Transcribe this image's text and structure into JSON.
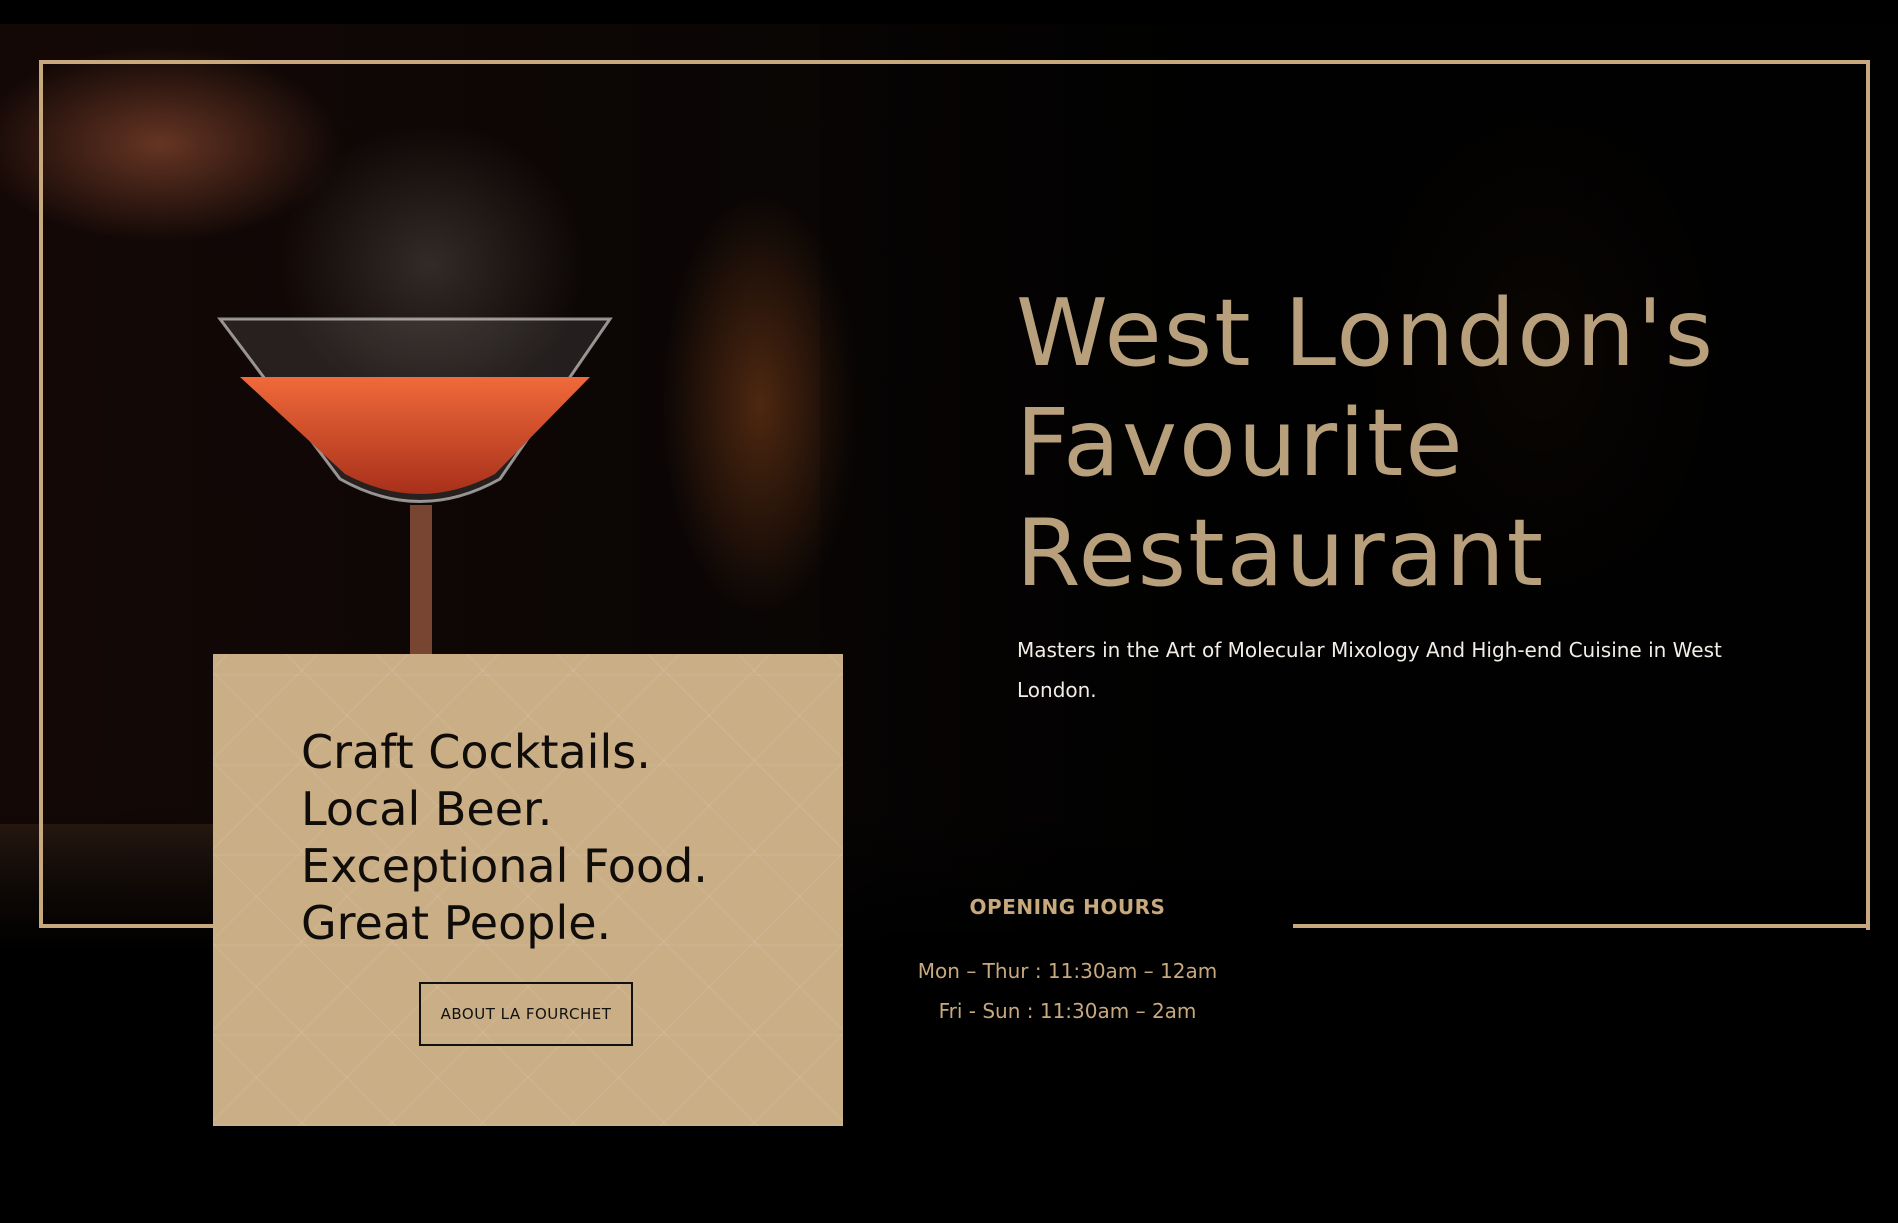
{
  "hero": {
    "headline_lines": [
      "West London's",
      "Favourite",
      "Restaurant"
    ],
    "tagline": "Masters in the Art of Molecular Mixology And High-end Cuisine in West London."
  },
  "hours": {
    "title": "OPENING HOURS",
    "lines": [
      "Mon – Thur : 11:30am – 12am",
      "Fri - Sun : 11:30am – 2am"
    ]
  },
  "card": {
    "lines": [
      "Craft Cocktails.",
      "Local Beer.",
      "Exceptional Food.",
      "Great People."
    ],
    "button_label": "ABOUT LA FOURCHET"
  },
  "colors": {
    "gold": "#c8a97e",
    "headline": "#b9a07c",
    "card_bg": "#c9ae86",
    "background": "#000000"
  }
}
